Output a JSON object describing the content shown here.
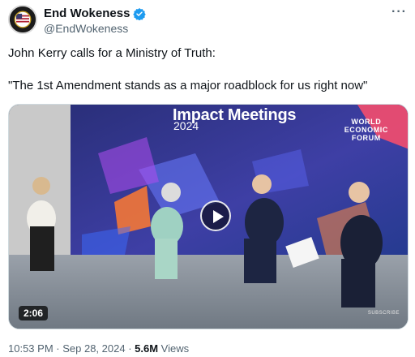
{
  "author": {
    "display_name": "End Wokeness",
    "handle": "@EndWokeness",
    "verified": true,
    "avatar_icon": "avatar-logo-icon",
    "avatar_text": "END WOKENESS"
  },
  "menu": {
    "more_label": "···"
  },
  "tweet": {
    "line1": "John Kerry calls for a Ministry of Truth:",
    "line2": "\"The 1st Amendment stands as a major roadblock for us right now\""
  },
  "media": {
    "title": "Impact Meetings",
    "year": "2024",
    "org_line1": "WORLD",
    "org_line2": "ECONOMIC",
    "org_line3": "FORUM",
    "subscribe": "SUBSCRIBE",
    "duration": "2:06"
  },
  "meta": {
    "time": "10:53 PM",
    "date": "Sep 28, 2024",
    "sep": " · ",
    "views_count": "5.6M",
    "views_label": "Views"
  },
  "colors": {
    "verified": "#1d9bf0",
    "text_primary": "#0f1419",
    "text_secondary": "#536471",
    "stage_backdrop": "#2b3a8a"
  }
}
